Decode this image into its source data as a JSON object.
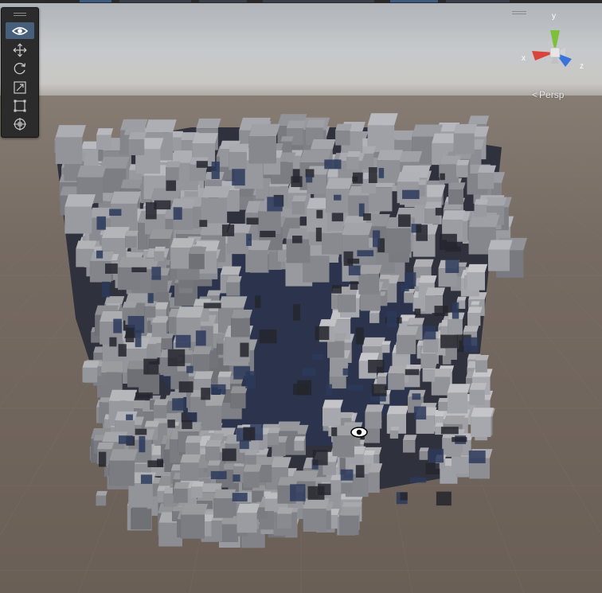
{
  "scene": {
    "projection_label": "Persp",
    "projection_chevron": "<",
    "gizmo": {
      "x_label": "x",
      "y_label": "y",
      "z_label": "z",
      "x_color": "#d9433a",
      "y_color": "#7ec03c",
      "z_color": "#3a73d9"
    }
  },
  "tools": [
    {
      "name": "view-tool",
      "icon": "eye-icon",
      "active": true
    },
    {
      "name": "move-tool",
      "icon": "move-arrows-icon",
      "active": false
    },
    {
      "name": "rotate-tool",
      "icon": "rotate-icon",
      "active": false
    },
    {
      "name": "scale-tool",
      "icon": "scale-icon",
      "active": false
    },
    {
      "name": "rect-tool",
      "icon": "rect-transform-icon",
      "active": false
    },
    {
      "name": "transform-tool",
      "icon": "transform-icon",
      "active": false
    }
  ],
  "colors": {
    "accent": "#46607c",
    "ground": "#6f655c",
    "voxel_light": "#8b8d93",
    "voxel_dark": "#2b2e38"
  }
}
